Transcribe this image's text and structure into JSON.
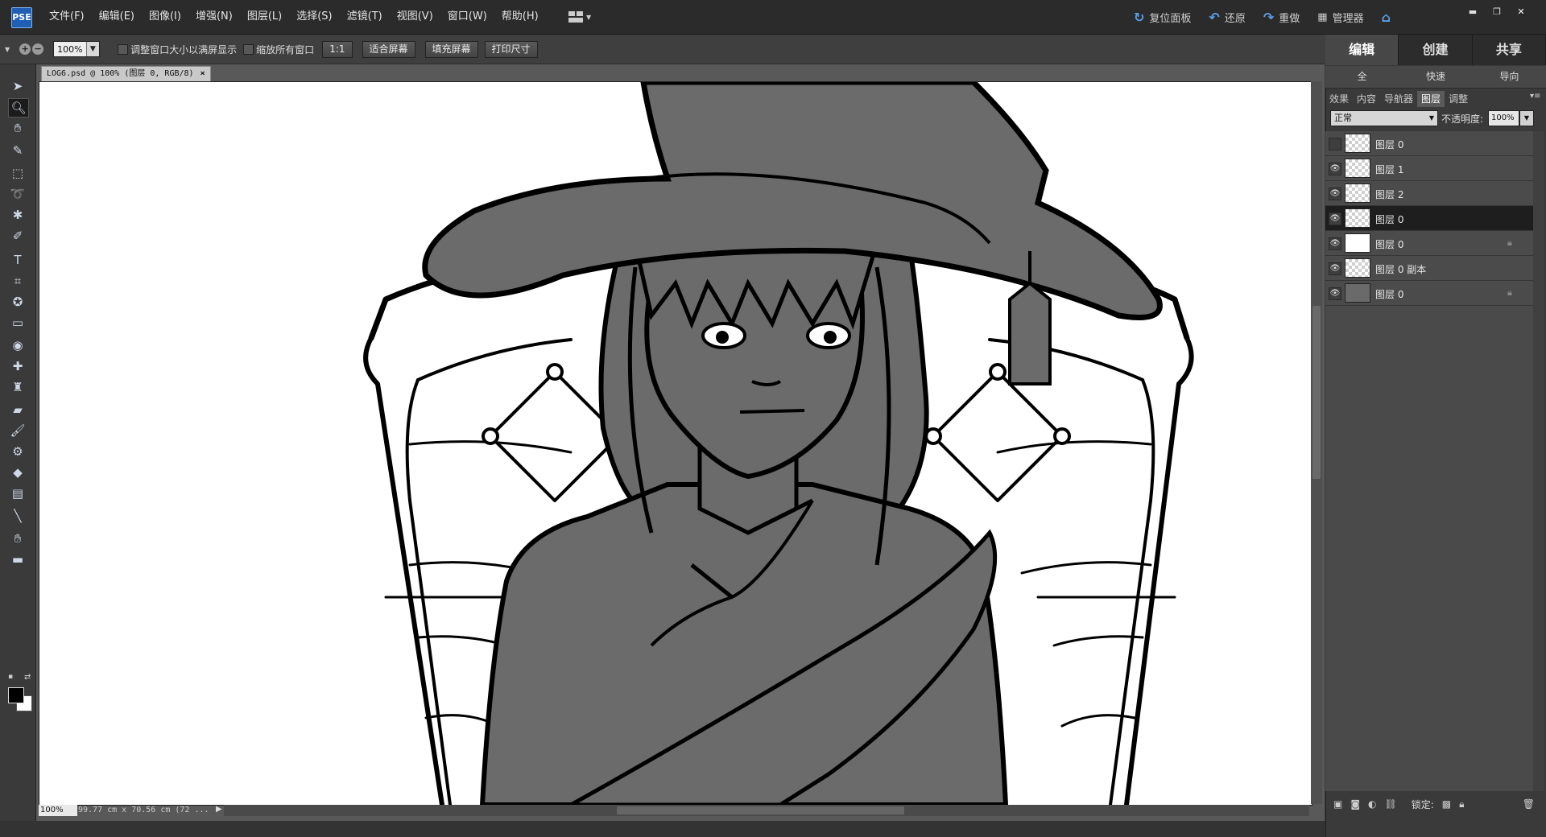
{
  "app": {
    "logo_text": "PSE"
  },
  "menu": {
    "items": [
      "文件(F)",
      "编辑(E)",
      "图像(I)",
      "增强(N)",
      "图层(L)",
      "选择(S)",
      "滤镜(T)",
      "视图(V)",
      "窗口(W)",
      "帮助(H)"
    ]
  },
  "top_actions": {
    "reset_panels": "复位面板",
    "undo": "还原",
    "redo": "重做",
    "organizer": "管理器"
  },
  "options": {
    "zoom_value": "100%",
    "resize_windows": "调整窗口大小以满屏显示",
    "zoom_all": "缩放所有窗口",
    "one_to_one": "1:1",
    "fit_screen": "适合屏幕",
    "fill_screen": "填充屏幕",
    "print_size": "打印尺寸"
  },
  "document": {
    "tab_title": "LOG6.psd @ 100% (图层 0, RGB/8)",
    "status_zoom": "100%",
    "status_info": "99.77 cm x 70.56 cm (72 ..."
  },
  "right_panel": {
    "mode_tabs": [
      "编辑",
      "创建",
      "共享"
    ],
    "sub_tabs": [
      "全",
      "快速",
      "导向"
    ],
    "panel_tabs": [
      "效果",
      "内容",
      "导航器",
      "图层",
      "调整"
    ],
    "blend_mode": "正常",
    "opacity_label": "不透明度:",
    "opacity_value": "100%",
    "lock_label": "锁定:",
    "layers": [
      {
        "name": "图层 0",
        "visible": false,
        "thumb": "checker",
        "locked": false,
        "active": false
      },
      {
        "name": "图层 1",
        "visible": true,
        "thumb": "checker",
        "locked": false,
        "active": false
      },
      {
        "name": "图层 2",
        "visible": true,
        "thumb": "checker",
        "locked": false,
        "active": false
      },
      {
        "name": "图层 0",
        "visible": true,
        "thumb": "checker",
        "locked": false,
        "active": true
      },
      {
        "name": "图层 0",
        "visible": true,
        "thumb": "white",
        "locked": true,
        "active": false
      },
      {
        "name": "图层 0 副本",
        "visible": true,
        "thumb": "checker",
        "locked": false,
        "active": false
      },
      {
        "name": "图层 0",
        "visible": true,
        "thumb": "gray",
        "locked": true,
        "active": false
      }
    ]
  },
  "colors": {
    "foreground": "#000000",
    "background": "#ffffff",
    "accent": "#5aa0e8",
    "figure_fill": "#6b6b6b"
  }
}
